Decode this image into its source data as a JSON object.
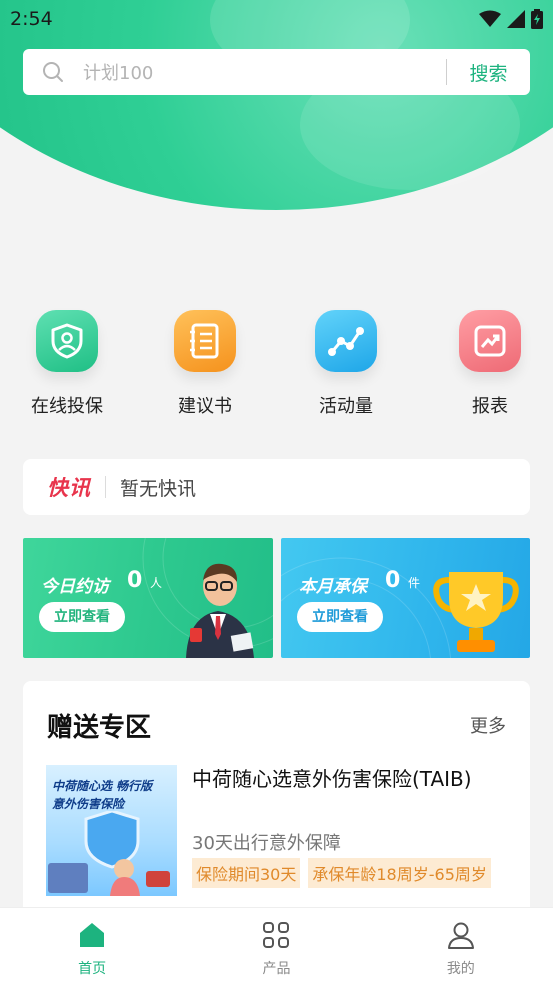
{
  "status_bar": {
    "time": "2:54"
  },
  "search": {
    "placeholder": "计划100",
    "button_label": "搜索"
  },
  "quick_entries": [
    {
      "label": "在线投保",
      "icon": "shield-user-icon",
      "color": "#2ccf94"
    },
    {
      "label": "建议书",
      "icon": "notebook-icon",
      "color": "#f8a12b"
    },
    {
      "label": "活动量",
      "icon": "activity-chart-icon",
      "color": "#2db3ec"
    },
    {
      "label": "报表",
      "icon": "report-icon",
      "color": "#f37a83"
    }
  ],
  "news": {
    "tag": "快讯",
    "text": "暂无快讯"
  },
  "banners": {
    "visits": {
      "title": "今日约访",
      "count": "0",
      "unit": "人",
      "button": "立即查看"
    },
    "policies": {
      "title": "本月承保",
      "count": "0",
      "unit": "件",
      "button": "立即查看"
    }
  },
  "gift": {
    "title": "赠送专区",
    "more": "更多",
    "product": {
      "name": "中荷随心选意外伤害保险(TAIB)",
      "subtitle": "30天出行意外保障",
      "tags": [
        "保险期间30天",
        "承保年龄18周岁-65周岁"
      ],
      "thumb_title": "中荷随心选 畅行版",
      "thumb_subtitle": "意外伤害保险"
    }
  },
  "bottom_nav": [
    {
      "label": "首页",
      "icon": "home-icon",
      "active": true
    },
    {
      "label": "产品",
      "icon": "grid-icon",
      "active": false
    },
    {
      "label": "我的",
      "icon": "user-icon",
      "active": false
    }
  ],
  "colors": {
    "accent": "#1db37f",
    "news_red": "#e8344c"
  }
}
